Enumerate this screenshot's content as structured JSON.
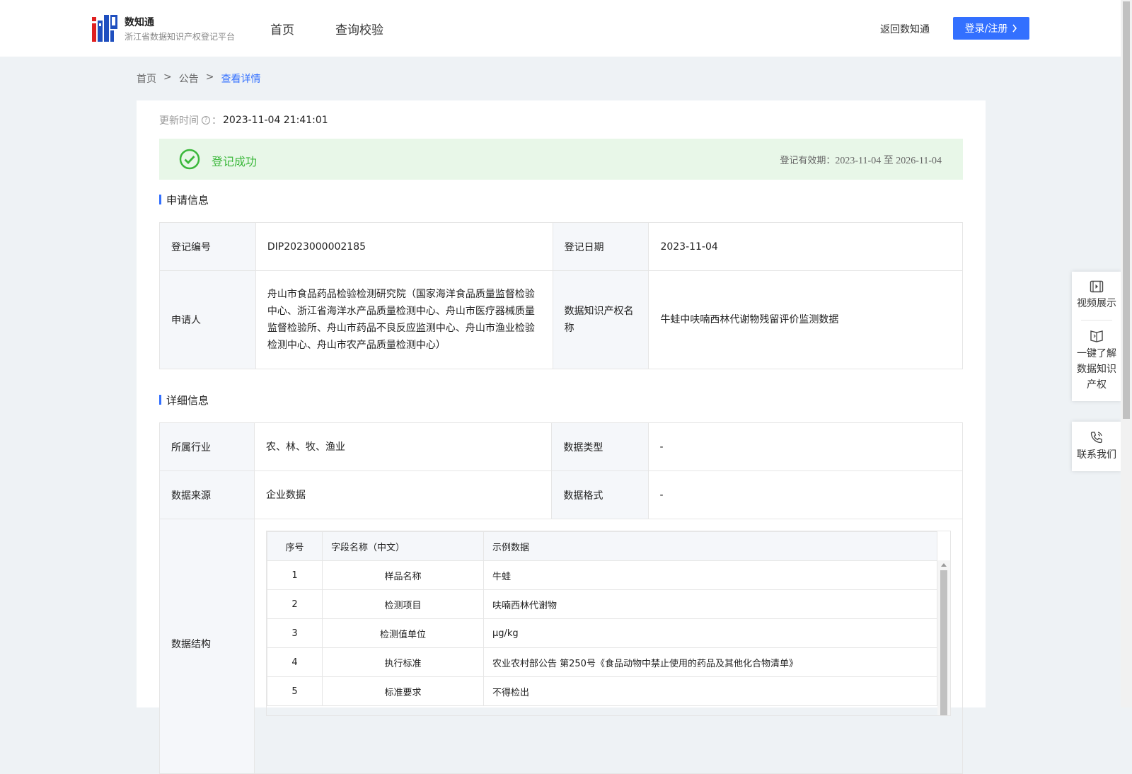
{
  "header": {
    "brand_name": "数知通",
    "brand_sub": "浙江省数据知识产权登记平台",
    "nav": [
      "首页",
      "查询校验"
    ],
    "back_link": "返回数知通",
    "login_label": "登录/注册"
  },
  "breadcrumb": [
    "首页",
    ">",
    "公告",
    ">",
    "查看详情"
  ],
  "update": {
    "label": "更新时间",
    "colon": "：",
    "value": "2023-11-04 21:41:01"
  },
  "status": {
    "text": "登记成功",
    "validity_label": "登记有效期：",
    "validity_dates": "2023-11-04 至 2026-11-04",
    "color": "#3cb83c"
  },
  "application": {
    "title": "申请信息",
    "reg_no_label": "登记编号",
    "reg_no": "DIP2023000002185",
    "reg_date_label": "登记日期",
    "reg_date": "2023-11-04",
    "applicant_label": "申请人",
    "applicant": "舟山市食品药品检验检测研究院（国家海洋食品质量监督检验中心、浙江省海洋水产品质量检测中心、舟山市医疗器械质量监督检验所、舟山市药品不良反应监测中心、舟山市渔业检验检测中心、舟山市农产品质量检测中心）",
    "ip_name_label": "数据知识产权名称",
    "ip_name": "牛蛙中呋喃西林代谢物残留评价监测数据"
  },
  "detail": {
    "title": "详细信息",
    "industry_label": "所属行业",
    "industry": "农、林、牧、渔业",
    "data_type_label": "数据类型",
    "data_type": "-",
    "source_label": "数据来源",
    "source": "企业数据",
    "format_label": "数据格式",
    "format": "-",
    "structure_label": "数据结构",
    "columns": [
      "序号",
      "字段名称（中文）",
      "示例数据"
    ],
    "rows": [
      [
        "1",
        "样品名称",
        "牛蛙"
      ],
      [
        "2",
        "检测项目",
        "呋喃西林代谢物"
      ],
      [
        "3",
        "检测值单位",
        "μg/kg"
      ],
      [
        "4",
        "执行标准",
        "农业农村部公告 第250号《食品动物中禁止使用的药品及其他化合物清单》"
      ],
      [
        "5",
        "标准要求",
        "不得检出"
      ]
    ]
  },
  "float_menu": {
    "video": "视频展示",
    "learn": "一键了解数据知识产权",
    "learn_lines": [
      "一键了解",
      "数据知识",
      "产权"
    ],
    "contact": "联系我们"
  },
  "colors": {
    "accent": "#3370ff",
    "success_bg": "#e8f7e8"
  }
}
